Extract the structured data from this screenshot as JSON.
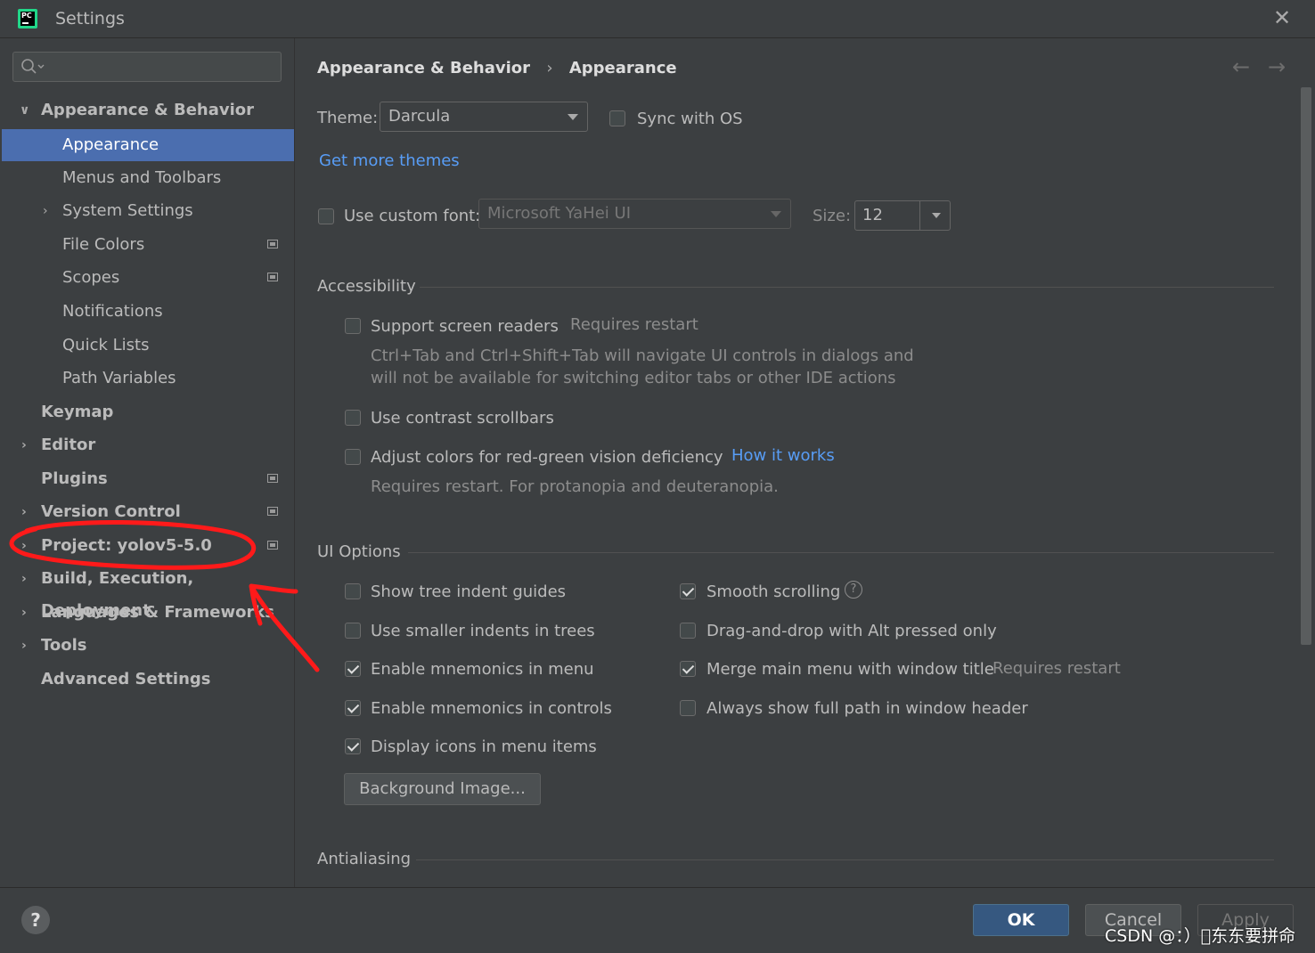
{
  "window": {
    "title": "Settings"
  },
  "sidebar": {
    "search_placeholder": "",
    "items": [
      {
        "label": "Appearance & Behavior",
        "expanded": true
      },
      {
        "label": "Appearance",
        "selected": true
      },
      {
        "label": "Menus and Toolbars"
      },
      {
        "label": "System Settings"
      },
      {
        "label": "File Colors"
      },
      {
        "label": "Scopes"
      },
      {
        "label": "Notifications"
      },
      {
        "label": "Quick Lists"
      },
      {
        "label": "Path Variables"
      },
      {
        "label": "Keymap"
      },
      {
        "label": "Editor"
      },
      {
        "label": "Plugins"
      },
      {
        "label": "Version Control"
      },
      {
        "label": "Project: yolov5-5.0"
      },
      {
        "label": "Build, Execution, Deployment"
      },
      {
        "label": "Languages & Frameworks"
      },
      {
        "label": "Tools"
      },
      {
        "label": "Advanced Settings"
      }
    ]
  },
  "breadcrumb": {
    "parent": "Appearance & Behavior",
    "separator": "›",
    "current": "Appearance"
  },
  "theme": {
    "label": "Theme:",
    "value": "Darcula",
    "sync_label": "Sync with OS",
    "sync_checked": false,
    "get_more": "Get more themes"
  },
  "font": {
    "label": "Use custom font:",
    "checked": false,
    "value": "Microsoft YaHei UI",
    "size_label": "Size:",
    "size_value": "12"
  },
  "accessibility": {
    "title": "Accessibility",
    "screen_readers": {
      "label": "Support screen readers",
      "checked": false,
      "note": "Requires restart",
      "desc1": "Ctrl+Tab and Ctrl+Shift+Tab will navigate UI controls in dialogs and",
      "desc2": "will not be available for switching editor tabs or other IDE actions"
    },
    "contrast": {
      "label": "Use contrast scrollbars",
      "checked": false
    },
    "color_vision": {
      "label": "Adjust colors for red-green vision deficiency",
      "checked": false,
      "link": "How it works",
      "desc": "Requires restart. For protanopia and deuteranopia."
    }
  },
  "ui_options": {
    "title": "UI Options",
    "left": [
      {
        "label": "Show tree indent guides",
        "checked": false
      },
      {
        "label": "Use smaller indents in trees",
        "checked": false
      },
      {
        "label": "Enable mnemonics in menu",
        "checked": true
      },
      {
        "label": "Enable mnemonics in controls",
        "checked": true
      },
      {
        "label": "Display icons in menu items",
        "checked": true
      }
    ],
    "right": [
      {
        "label": "Smooth scrolling",
        "checked": true
      },
      {
        "label": "Drag-and-drop with Alt pressed only",
        "checked": false
      },
      {
        "label": "Merge main menu with window title",
        "checked": true,
        "note": "Requires restart"
      },
      {
        "label": "Always show full path in window header",
        "checked": false
      }
    ],
    "background_button": "Background Image..."
  },
  "antialiasing": {
    "title": "Antialiasing"
  },
  "footer": {
    "help": "?",
    "ok": "OK",
    "cancel": "Cancel",
    "apply": "Apply"
  },
  "watermark": "CSDN @：）\u0000东东要拼命",
  "colors": {
    "selection": "#4b6eaf",
    "link": "#589df6",
    "annotation": "#ff1a1a",
    "ok_button": "#365880"
  }
}
